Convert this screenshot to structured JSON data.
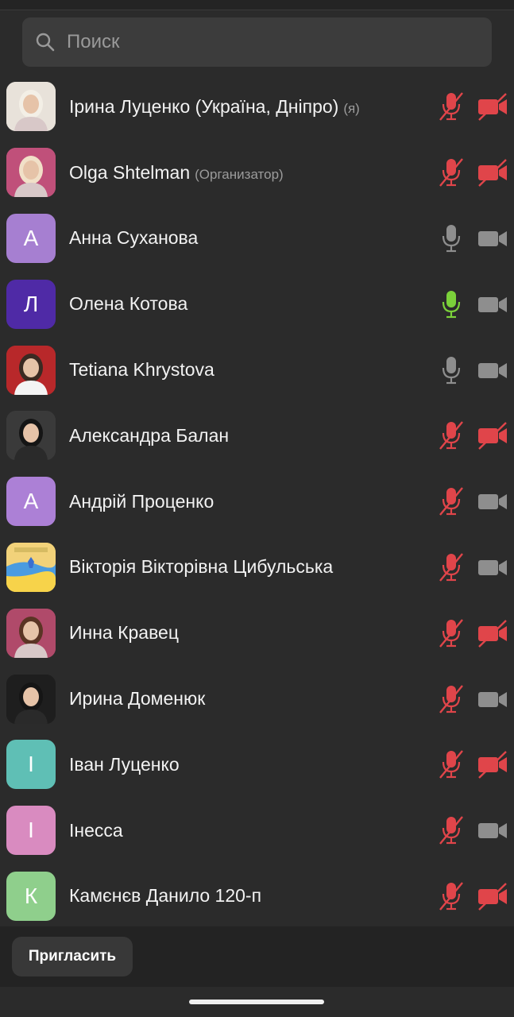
{
  "search": {
    "placeholder": "Поиск"
  },
  "participants": [
    {
      "name": "Ірина Луценко (Україна, Дніпро)",
      "tag": "(я)",
      "avatar_type": "photo",
      "avatar_letter": "",
      "avatar_color": "#e8e2da",
      "mic": "muted",
      "cam": "off"
    },
    {
      "name": "Olga Shtelman",
      "tag": "(Организатор)",
      "avatar_type": "photo",
      "avatar_letter": "",
      "avatar_color": "#c0507a",
      "mic": "muted",
      "cam": "off"
    },
    {
      "name": "Анна Суханова",
      "tag": "",
      "avatar_type": "letter",
      "avatar_letter": "А",
      "avatar_color": "#a67fd1",
      "mic": "on",
      "cam": "on"
    },
    {
      "name": "Олена Котова",
      "tag": "",
      "avatar_type": "letter",
      "avatar_letter": "Л",
      "avatar_color": "#4f2aa6",
      "mic": "speaking",
      "cam": "on"
    },
    {
      "name": "Tetiana Khrystova",
      "tag": "",
      "avatar_type": "photo",
      "avatar_letter": "",
      "avatar_color": "#b8282a",
      "mic": "on",
      "cam": "on"
    },
    {
      "name": "Александра Балан",
      "tag": "",
      "avatar_type": "photo",
      "avatar_letter": "",
      "avatar_color": "#3a3a3a",
      "mic": "muted",
      "cam": "off"
    },
    {
      "name": "Андрій Проценко",
      "tag": "",
      "avatar_type": "letter",
      "avatar_letter": "А",
      "avatar_color": "#ac80d6",
      "mic": "muted",
      "cam": "on"
    },
    {
      "name": "Вікторія Вікторівна Цибульська",
      "tag": "",
      "avatar_type": "photo",
      "avatar_letter": "",
      "avatar_color": "#f2cf4a",
      "mic": "muted",
      "cam": "on"
    },
    {
      "name": "Инна Кравец",
      "tag": "",
      "avatar_type": "photo",
      "avatar_letter": "",
      "avatar_color": "#b04a6a",
      "mic": "muted",
      "cam": "off"
    },
    {
      "name": "Ирина Доменюк",
      "tag": "",
      "avatar_type": "photo",
      "avatar_letter": "",
      "avatar_color": "#1e1e1e",
      "mic": "muted",
      "cam": "on"
    },
    {
      "name": "Іван Луценко",
      "tag": "",
      "avatar_type": "letter",
      "avatar_letter": "І",
      "avatar_color": "#5fbfb5",
      "mic": "muted",
      "cam": "off"
    },
    {
      "name": "Інесса",
      "tag": "",
      "avatar_type": "letter",
      "avatar_letter": "І",
      "avatar_color": "#d98bc0",
      "mic": "muted",
      "cam": "on"
    },
    {
      "name": "Камєнєв Данило 120-п",
      "tag": "",
      "avatar_type": "letter",
      "avatar_letter": "К",
      "avatar_color": "#8fcf8c",
      "mic": "muted",
      "cam": "off"
    }
  ],
  "footer": {
    "invite_label": "Пригласить"
  },
  "colors": {
    "muted": "#e0454a",
    "speaking": "#7bd13a",
    "neutral": "#8e8e8e",
    "background": "#2b2b2b"
  }
}
